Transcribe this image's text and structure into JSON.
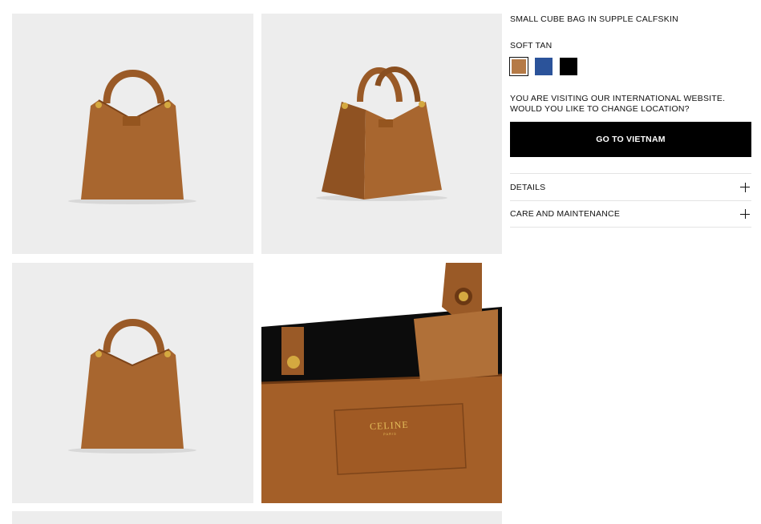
{
  "product": {
    "title": "SMALL CUBE BAG IN SUPPLE CALFSKIN",
    "selected_color": "SOFT TAN"
  },
  "swatches": [
    {
      "name": "soft-tan",
      "color": "#b57a46",
      "selected": true
    },
    {
      "name": "blue",
      "color": "#2b539a",
      "selected": false
    },
    {
      "name": "black",
      "color": "#000000",
      "selected": false
    }
  ],
  "location": {
    "notice_line1": "YOU ARE VISITING OUR INTERNATIONAL WEBSITE.",
    "notice_line2": "WOULD YOU LIKE TO CHANGE LOCATION?",
    "button_label": "GO TO VIETNAM"
  },
  "accordion": [
    {
      "label": "DETAILS"
    },
    {
      "label": "CARE AND MAINTENANCE"
    }
  ],
  "gallery": {
    "label_brand": "CELINE",
    "label_city": "PARIS"
  },
  "colors": {
    "leather": "#a45f28",
    "leather_dark": "#7d4419",
    "tile_bg": "#ededed"
  }
}
